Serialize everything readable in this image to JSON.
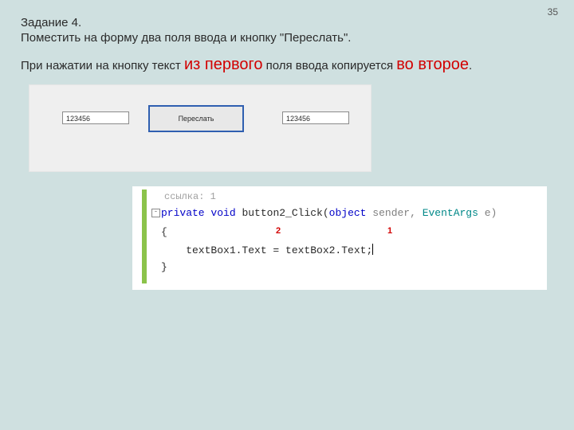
{
  "page_number": "35",
  "task": {
    "title": "Задание 4.",
    "line1": "Поместить на форму два поля ввода и кнопку \"Переслать\".",
    "line2_a": "При нажатии на кнопку текст ",
    "line2_em1": "из первого",
    "line2_b": " поля ввода копируется ",
    "line2_em2": "во второе",
    "line2_c": "."
  },
  "form": {
    "textbox1": "123456",
    "textbox2": "123456",
    "button_label": "Переслать"
  },
  "editor": {
    "hint": "ссылка: 1",
    "minus": "-",
    "sig_kw1": "private",
    "sig_kw2": "void",
    "sig_name": " button2_Click(",
    "sig_kw3": "object",
    "sig_mid": " sender, ",
    "sig_type": "EventArgs",
    "sig_end": " e)",
    "brace_open": "{",
    "body": "    textBox1.Text = textBox2.Text;",
    "brace_close": "}",
    "anno1": "1",
    "anno2": "2"
  }
}
